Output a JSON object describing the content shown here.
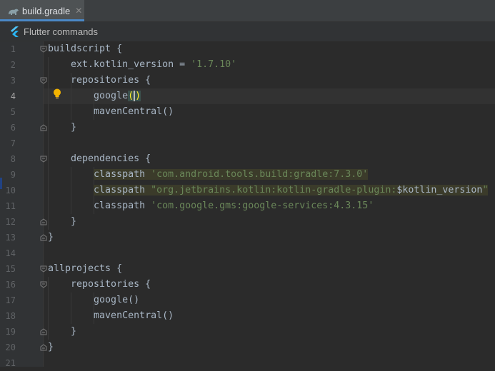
{
  "tab": {
    "label": "build.gradle",
    "close_glyph": "✕",
    "icon": "gradle-icon"
  },
  "toolbar": {
    "label": "Flutter commands",
    "icon": "flutter-icon"
  },
  "editor": {
    "current_line": 4,
    "lines": [
      {
        "n": "1",
        "code": "buildscript {"
      },
      {
        "n": "2",
        "code": "    ext.kotlin_version = ",
        "str": "'1.7.10'"
      },
      {
        "n": "3",
        "code": "    repositories {"
      },
      {
        "n": "4",
        "code": "        google()"
      },
      {
        "n": "5",
        "code": "        mavenCentral()"
      },
      {
        "n": "6",
        "code": "    }"
      },
      {
        "n": "7",
        "code": ""
      },
      {
        "n": "8",
        "code": "    dependencies {"
      },
      {
        "n": "9",
        "code": "        classpath ",
        "str": "'com.android.tools.build:gradle:7.3.0'"
      },
      {
        "n": "10",
        "code": "        classpath ",
        "str": "\"org.jetbrains.kotlin:kotlin-gradle-plugin:",
        "var": "$kotlin_version",
        "str2": "\""
      },
      {
        "n": "11",
        "code": "        classpath ",
        "str": "'com.google.gms:google-services:4.3.15'"
      },
      {
        "n": "12",
        "code": "    }"
      },
      {
        "n": "13",
        "code": "}"
      },
      {
        "n": "14",
        "code": ""
      },
      {
        "n": "15",
        "code": "allprojects {"
      },
      {
        "n": "16",
        "code": "    repositories {"
      },
      {
        "n": "17",
        "code": "        google()"
      },
      {
        "n": "18",
        "code": "        mavenCentral()"
      },
      {
        "n": "19",
        "code": "    }"
      },
      {
        "n": "20",
        "code": "}"
      },
      {
        "n": "21",
        "code": ""
      }
    ]
  },
  "colors": {
    "background": "#2b2b2b",
    "keyword_text": "#a9b7c6",
    "string": "#6a8759",
    "line_number": "#606366",
    "tab_accent": "#4a88c7",
    "highlight": "#3b3b2a"
  }
}
